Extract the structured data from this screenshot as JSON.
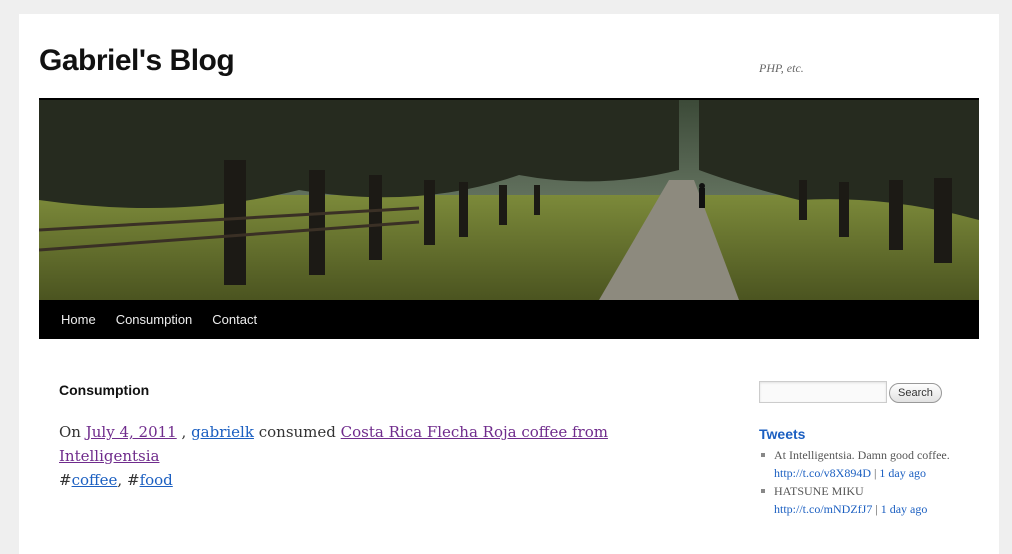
{
  "site": {
    "title": "Gabriel's Blog",
    "description": "PHP, etc."
  },
  "nav": {
    "items": [
      "Home",
      "Consumption",
      "Contact"
    ]
  },
  "entry": {
    "title": "Consumption",
    "prefix": "On",
    "date": "July 4, 2011",
    "sep": ",",
    "author": "gabrielk",
    "verb": "consumed",
    "item": "Costa Rica Flecha Roja coffee from Intelligentsia",
    "hash": "#",
    "tag1": "coffee",
    "comma": ",",
    "tag2": "food"
  },
  "sidebar": {
    "search_button": "Search",
    "tweets_title": "Tweets",
    "tweets": [
      {
        "text": "At Intelligentsia. Damn good coffee.",
        "link": "http://t.co/v8X894D",
        "sep": "|",
        "time": "1 day ago"
      },
      {
        "text": "HATSUNE MIKU",
        "link": "http://t.co/mNDZfJ7",
        "sep": "|",
        "time": "1 day ago"
      }
    ]
  },
  "colors": {
    "link": "#1b5fc1",
    "visited_link": "#6f2b8c",
    "nav_background": "#000000",
    "page_background": "#efefef"
  }
}
